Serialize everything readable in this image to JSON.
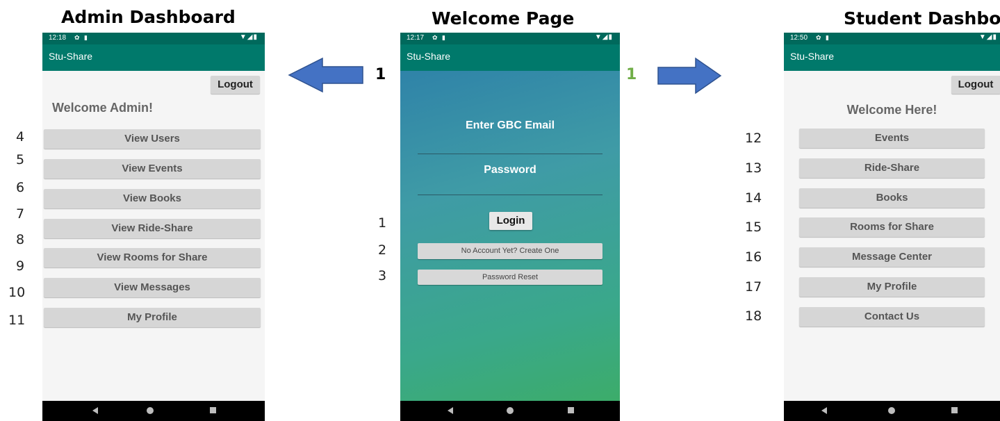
{
  "titles": {
    "admin": "Admin Dashboard",
    "welcome": "Welcome Page",
    "student": "Student Dashboard"
  },
  "arrow_labels": {
    "left": "1",
    "right": "1"
  },
  "colors": {
    "status_bar": "#00695c",
    "app_bar": "#00796b",
    "arrow": "#4472c4",
    "right_arrow_label": "#70ad47",
    "button_bg": "#d6d6d6"
  },
  "status_icons": [
    "gear-icon",
    "sd-card-icon",
    "wifi-icon",
    "signal-icon",
    "battery-icon"
  ],
  "admin": {
    "time": "12:18",
    "app_title": "Stu-Share",
    "logout": "Logout",
    "welcome": "Welcome Admin!",
    "buttons": [
      {
        "num": "4",
        "label": "View Users"
      },
      {
        "num": "5",
        "label": "View Events"
      },
      {
        "num": "6",
        "label": "View Books"
      },
      {
        "num": "7",
        "label": "View Ride-Share"
      },
      {
        "num": "8",
        "label": "View Rooms for Share"
      },
      {
        "num": "9",
        "label": "View Messages"
      },
      {
        "num": "10",
        "label": "My Profile"
      },
      {
        "num": "11",
        "label": ""
      }
    ]
  },
  "login": {
    "time": "12:17",
    "app_title": "Stu-Share",
    "email_label": "Enter GBC Email",
    "password_label": "Password",
    "login_button": "Login",
    "create_account": "No Account Yet? Create One",
    "password_reset": "Password Reset",
    "nums": [
      "1",
      "2",
      "3"
    ]
  },
  "student": {
    "time": "12:50",
    "app_title": "Stu-Share",
    "logout": "Logout",
    "welcome": "Welcome Here!",
    "buttons": [
      {
        "num": "12",
        "label": "Events"
      },
      {
        "num": "13",
        "label": "Ride-Share"
      },
      {
        "num": "14",
        "label": "Books"
      },
      {
        "num": "15",
        "label": "Rooms for Share"
      },
      {
        "num": "16",
        "label": "Message Center"
      },
      {
        "num": "17",
        "label": "My Profile"
      },
      {
        "num": "18",
        "label": "Contact Us"
      }
    ]
  }
}
